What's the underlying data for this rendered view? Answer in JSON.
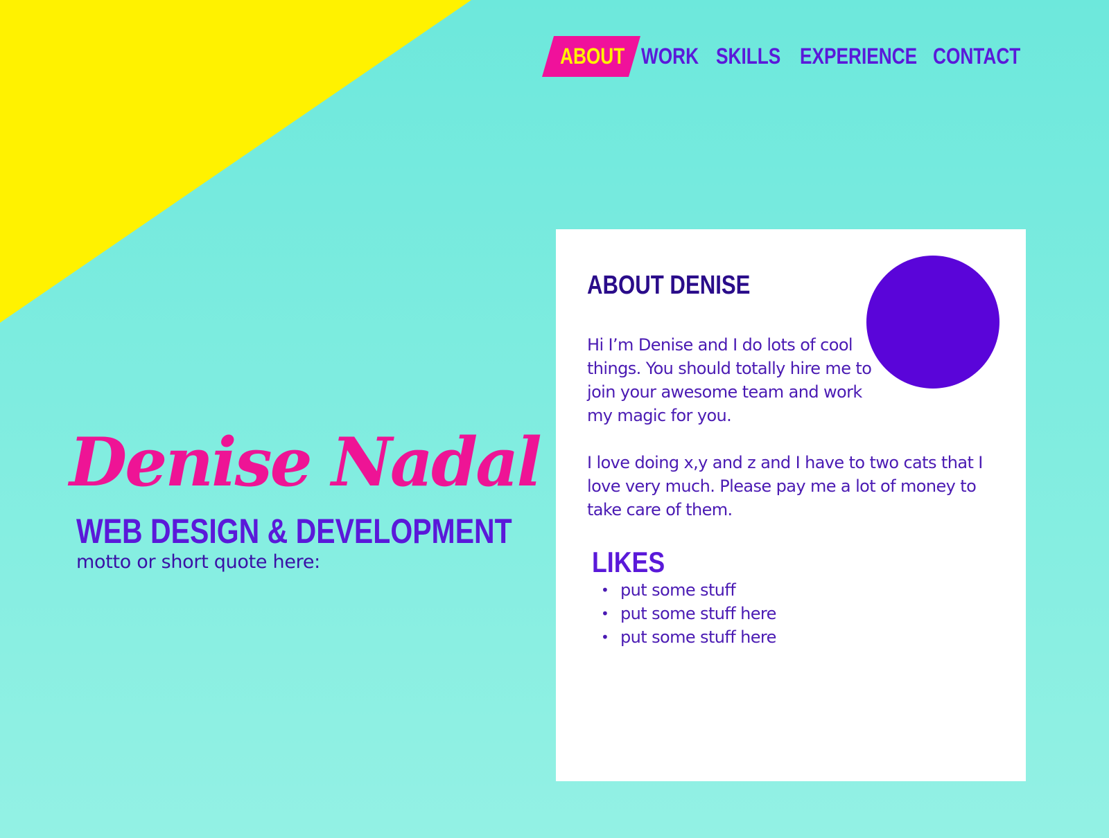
{
  "nav": {
    "items": [
      {
        "label": "ABOUT",
        "active": true
      },
      {
        "label": "WORK",
        "active": false
      },
      {
        "label": "SKILLS",
        "active": false
      },
      {
        "label": "EXPERIENCE",
        "active": false
      },
      {
        "label": "CONTACT",
        "active": false
      }
    ]
  },
  "hero": {
    "name": "Denise Nadal",
    "subtitle": "WEB DESIGN & DEVELOPMENT",
    "motto": "motto or short quote here:"
  },
  "about": {
    "title": "ABOUT DENISE",
    "bio_1": "Hi I’m Denise and I do lots of cool things. You should totally hire me to join your awesome team and work my magic for you.",
    "bio_2": "I love doing x,y and z and I have to two cats that I love very much. Please pay me a lot of money to take care of them.",
    "likes_title": "LIKES",
    "likes": [
      "put some stuff",
      "put some stuff here",
      "put some stuff here"
    ]
  },
  "colors": {
    "background_top": "#6de8dc",
    "background_bottom": "#93f1e4",
    "yellow": "#fff200",
    "pink": "#ee1495",
    "purple": "#5a19d9",
    "avatar": "#5a05d9"
  }
}
